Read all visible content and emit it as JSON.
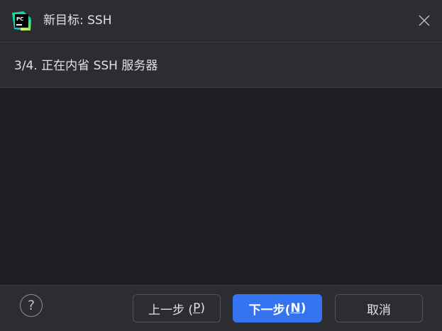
{
  "window": {
    "title": "新目标: SSH",
    "app_icon": "pycharm-logo-icon",
    "close_icon": "close-icon"
  },
  "step": {
    "text": "3/4. 正在内省 SSH 服务器"
  },
  "footer": {
    "help_label": "?",
    "back": {
      "label_prefix": "上一步 (",
      "mnemonic": "P",
      "label_suffix": ")"
    },
    "next": {
      "label_prefix": "下一步(",
      "mnemonic": "N",
      "label_suffix": ")"
    },
    "cancel_label": "取消"
  },
  "colors": {
    "accent": "#3574f0",
    "panel": "#2b2d30",
    "background": "#1e1f22",
    "text": "#dfe1e5"
  }
}
